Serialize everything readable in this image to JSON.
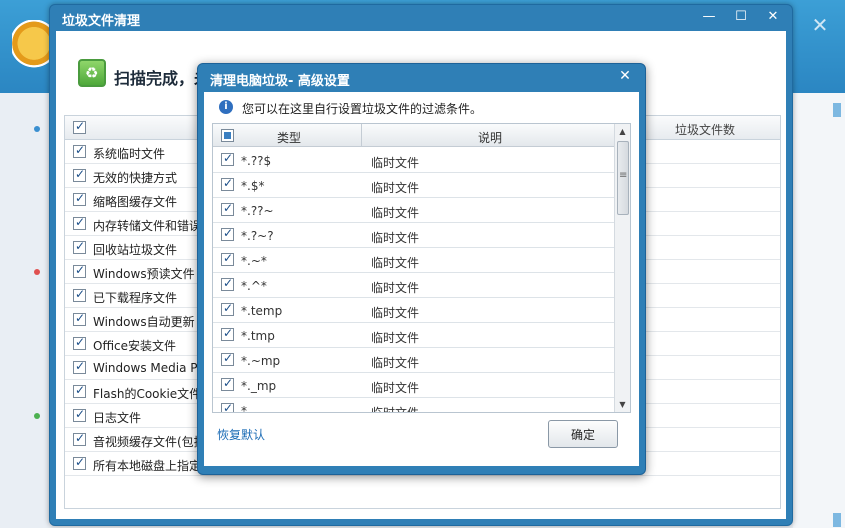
{
  "main_window": {
    "title": "垃圾文件清理",
    "controls": {
      "minimize": "—",
      "maximize": "☐",
      "close": "✕"
    },
    "scan_status": "扫描完成，未"
  },
  "background": {
    "close_glyph": "✕"
  },
  "junk_list": {
    "header": {
      "count_column": "垃圾文件数"
    },
    "items": [
      {
        "label": "系统临时文件"
      },
      {
        "label": "无效的快捷方式"
      },
      {
        "label": "缩略图缓存文件"
      },
      {
        "label": "内存转储文件和错误"
      },
      {
        "label": "回收站垃圾文件"
      },
      {
        "label": "Windows预读文件"
      },
      {
        "label": "已下载程序文件"
      },
      {
        "label": "Windows自动更新"
      },
      {
        "label": "Office安装文件"
      },
      {
        "label": "Windows Media P"
      },
      {
        "label": "Flash的Cookie文件"
      },
      {
        "label": "日志文件"
      },
      {
        "label": "音视频缓存文件(包括"
      },
      {
        "label": "所有本地磁盘上指定"
      }
    ]
  },
  "dialog": {
    "title": "清理电脑垃圾- 高级设置",
    "close_glyph": "✕",
    "info": "您可以在这里自行设置垃圾文件的过滤条件。",
    "columns": {
      "type": "类型",
      "description": "说明"
    },
    "rows": [
      {
        "type": "*.??$",
        "description": "临时文件"
      },
      {
        "type": "*.$*",
        "description": "临时文件"
      },
      {
        "type": "*.??~",
        "description": "临时文件"
      },
      {
        "type": "*.?~?",
        "description": "临时文件"
      },
      {
        "type": "*.~*",
        "description": "临时文件"
      },
      {
        "type": "*.^*",
        "description": "临时文件"
      },
      {
        "type": "*.temp",
        "description": "临时文件"
      },
      {
        "type": "*.tmp",
        "description": "临时文件"
      },
      {
        "type": "*.~mp",
        "description": "临时文件"
      },
      {
        "type": "*._mp",
        "description": "临时文件"
      },
      {
        "type": "*.",
        "description": "临时文件"
      }
    ],
    "restore_default": "恢复默认",
    "ok": "确定"
  }
}
